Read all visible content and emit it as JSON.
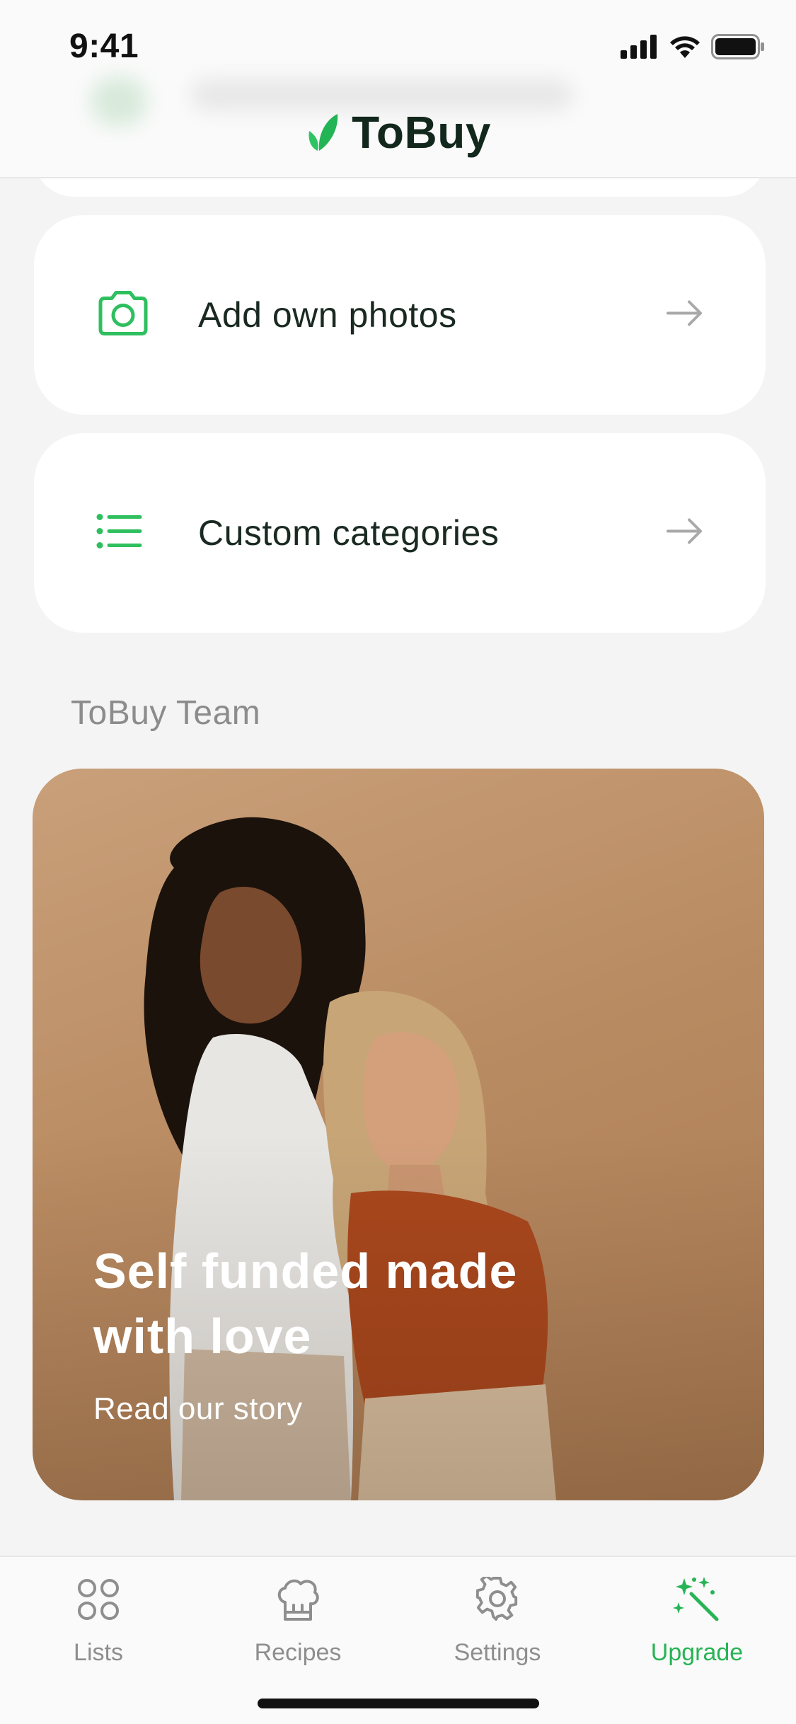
{
  "status_bar": {
    "time": "9:41"
  },
  "header": {
    "brand": "ToBuy"
  },
  "features": [
    {
      "label": "Add own photos",
      "icon": "camera-icon"
    },
    {
      "label": "Custom categories",
      "icon": "list-icon"
    }
  ],
  "team_section": {
    "title": "ToBuy Team",
    "story_title": "Self funded made with love",
    "story_link": "Read our story"
  },
  "tabbar": {
    "tabs": [
      {
        "label": "Lists",
        "icon": "grid-circles-icon",
        "active": false
      },
      {
        "label": "Recipes",
        "icon": "chef-hat-icon",
        "active": false
      },
      {
        "label": "Settings",
        "icon": "gear-icon",
        "active": false
      },
      {
        "label": "Upgrade",
        "icon": "magic-wand-icon",
        "active": true
      }
    ]
  },
  "colors": {
    "accent": "#27b455",
    "background": "#f4f4f4",
    "card": "#ffffff",
    "text": "#1a2a22",
    "muted": "#8c8c8c"
  }
}
